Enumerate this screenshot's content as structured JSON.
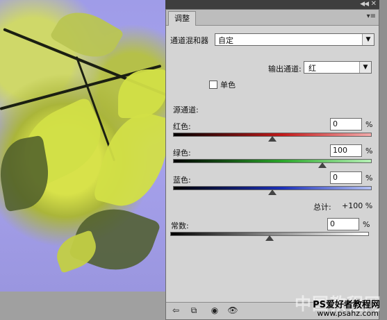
{
  "panel": {
    "tab_label": "调整",
    "menu_icon": "panel-menu-icon",
    "preset": {
      "label": "通道混和器",
      "value": "自定"
    },
    "output_channel": {
      "label": "输出通道:",
      "value": "红"
    },
    "monochrome": {
      "label": "单色",
      "checked": false
    },
    "source_label": "源通道:",
    "channels": [
      {
        "label": "红色:",
        "value": "0",
        "unit": "%",
        "position": 0.5
      },
      {
        "label": "绿色:",
        "value": "100",
        "unit": "%",
        "position": 0.75
      },
      {
        "label": "蓝色:",
        "value": "0",
        "unit": "%",
        "position": 0.5
      }
    ],
    "total": {
      "label": "总计:",
      "value": "+100 %"
    },
    "constant": {
      "label": "常数:",
      "value": "0",
      "unit": "%",
      "position": 0.5
    },
    "colors": {
      "panel_bg": "#d4d4d4",
      "red": "#c21a1a",
      "green": "#2aa52a",
      "blue": "#1a2fb8"
    }
  },
  "watermark": {
    "main": "中国教程网",
    "line1": "PS爱好者教程网",
    "url": "www.psahz.com"
  }
}
